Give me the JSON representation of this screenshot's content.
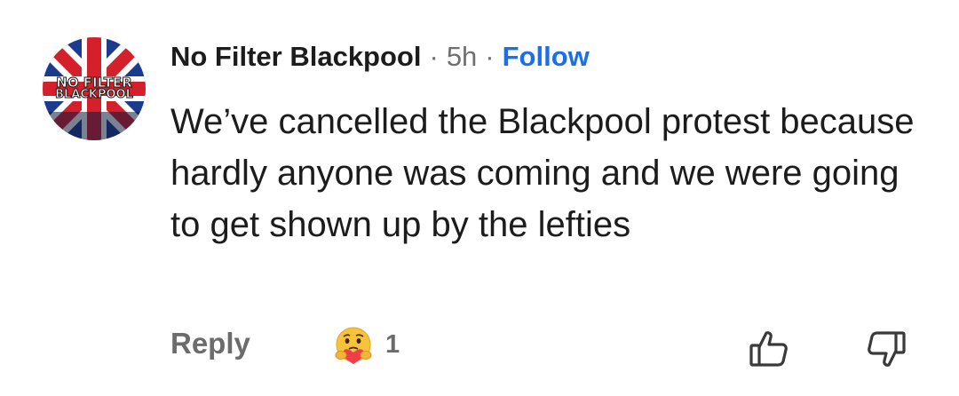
{
  "comment": {
    "avatar": {
      "logo_line1": "NO FILTER",
      "logo_line2": "BLACKPOOL",
      "flag_colors": [
        "#1b3b8f",
        "#d4202a",
        "#ffffff"
      ]
    },
    "author": "No Filter Blackpool",
    "separator": "·",
    "time": "5h",
    "follow_label": "Follow",
    "text": "We’ve cancelled the Blackpool protest because hardly anyone was coming and we were going to get shown up by the lefties",
    "reply_label": "Reply",
    "reaction": {
      "icon": "care-emoji-icon",
      "count": "1"
    },
    "upvote_icon": "thumbs-up-icon",
    "downvote_icon": "thumbs-down-icon",
    "accent_color": "#1c6fe8"
  }
}
